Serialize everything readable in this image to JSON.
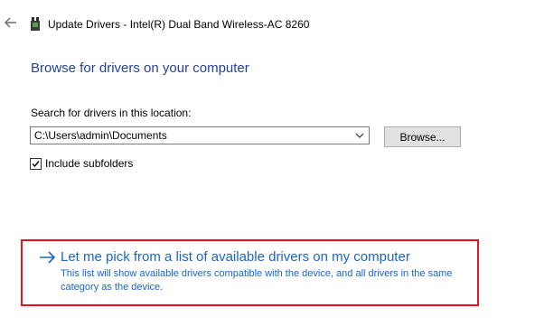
{
  "window": {
    "title": "Update Drivers - Intel(R) Dual Band Wireless-AC 8260",
    "back_icon": "arrow-left-icon",
    "device_icon": "network-adapter-icon"
  },
  "main": {
    "heading": "Browse for drivers on your computer",
    "location_label": "Search for drivers in this location:",
    "path_value": "C:\\Users\\admin\\Documents",
    "browse_label": "Browse...",
    "include_subfolders_label": "Include subfolders",
    "include_subfolders_checked": true
  },
  "pick_option": {
    "title": "Let me pick from a list of available drivers on my computer",
    "description": "This list will show available drivers compatible with the device, and all drivers in the same category as the device.",
    "arrow_icon": "arrow-right-icon"
  },
  "colors": {
    "heading": "#24429c",
    "link": "#1a66c2",
    "highlight_border": "#e8131b"
  }
}
